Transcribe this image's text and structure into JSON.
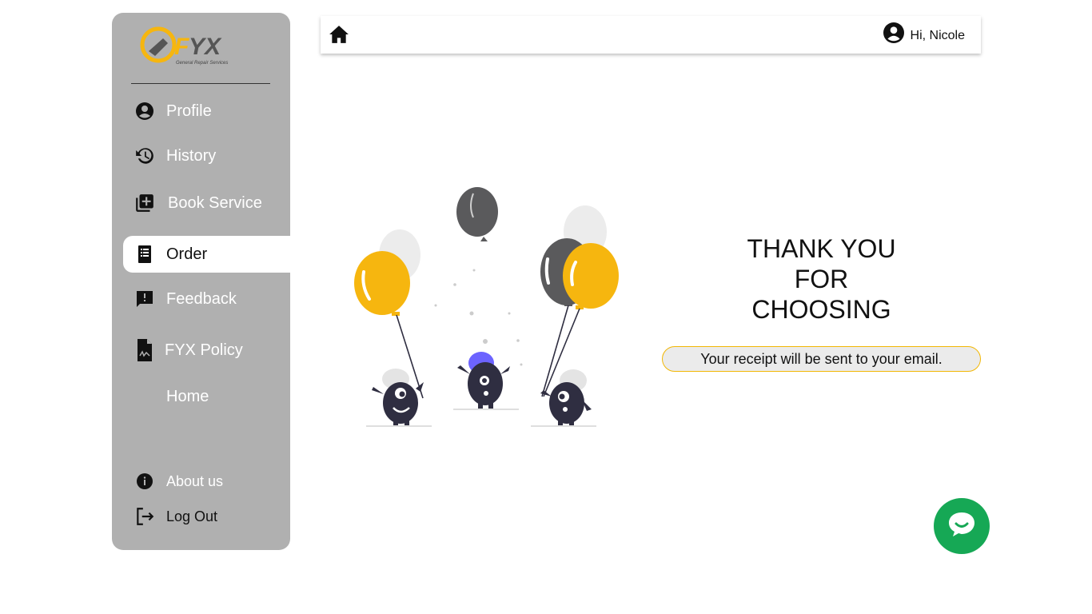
{
  "sidebar": {
    "logo_text": "FYX",
    "logo_tagline": "General Repair Services",
    "items": [
      {
        "label": "Profile",
        "icon": "account-circle-icon"
      },
      {
        "label": "History",
        "icon": "history-icon"
      },
      {
        "label": "Book Service",
        "icon": "library-add-icon"
      },
      {
        "label": "Order",
        "icon": "receipt-icon"
      },
      {
        "label": "Feedback",
        "icon": "feedback-icon"
      },
      {
        "label": "FYX Policy",
        "icon": "policy-document-icon"
      },
      {
        "label": "Home",
        "icon": ""
      }
    ],
    "bottom_items": [
      {
        "label": "About us",
        "icon": "info-icon"
      },
      {
        "label": "Log Out",
        "icon": "logout-icon"
      }
    ],
    "active_item": "Order"
  },
  "topbar": {
    "home_icon": "home-icon",
    "user_icon": "account-circle-icon",
    "greeting": "Hi, Nicole"
  },
  "main": {
    "thanks_line1": "THANK YOU",
    "thanks_line2": "FOR",
    "thanks_line3": "CHOOSING",
    "receipt_message": "Your receipt will be sent to your email."
  },
  "chat": {
    "icon": "chat-bubble-icon"
  },
  "colors": {
    "sidebar_bg": "#b0b0b0",
    "accent_yellow": "#f6b60f",
    "chat_green": "#16a855",
    "balloon_dark": "#5a5a5c",
    "monster": "#2f2e41",
    "monster_hat": "#6c63ff"
  }
}
